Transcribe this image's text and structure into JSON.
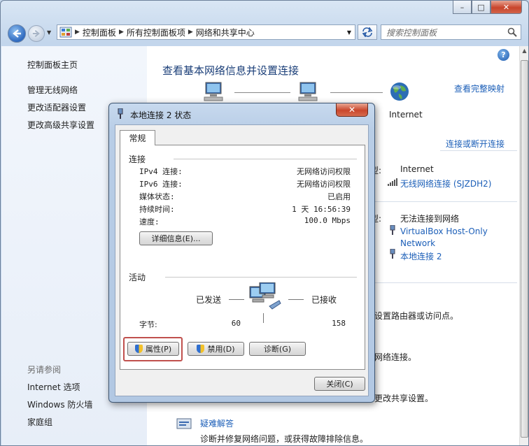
{
  "window": {
    "caption_buttons": {
      "minimize": "–",
      "maximize": "□",
      "close": "✕"
    }
  },
  "addressbar": {
    "crumbs": [
      "控制面板",
      "所有控制面板项",
      "网络和共享中心"
    ],
    "search_placeholder": "搜索控制面板"
  },
  "sidebar": {
    "home": "控制面板主页",
    "links": [
      "管理无线网络",
      "更改适配器设置",
      "更改高级共享设置"
    ],
    "see_also": "另请参阅",
    "see_also_links": [
      "Internet 选项",
      "Windows 防火墙",
      "家庭组"
    ]
  },
  "main": {
    "title": "查看基本网络信息并设置连接",
    "see_full_map": "查看完整映射",
    "internet_label": "Internet",
    "connect_disconnect": "连接或断开连接",
    "net1": {
      "type_label": "型:",
      "type_value": "Internet",
      "conn_link": "无线网络连接 (SJZDH2)"
    },
    "net2": {
      "type_label": "型:",
      "type_value": "无法连接到网络",
      "conn_link1": "VirtualBox Host-Only",
      "conn_link1b": "Network",
      "conn_link2": "本地连接 2"
    },
    "frag1": "设置路由器或访问点。",
    "frag2": "网络连接。",
    "frag3": "更改共享设置。",
    "troubleshoot": "疑难解答",
    "troubleshoot_desc": "诊断并修复网络问题，或获得故障排除信息。"
  },
  "dialog": {
    "title": "本地连接 2 状态",
    "close": "✕",
    "tab": "常规",
    "connection_group": "连接",
    "rows": [
      {
        "label": "IPv4 连接:",
        "value": "无网络访问权限"
      },
      {
        "label": "IPv6 连接:",
        "value": "无网络访问权限"
      },
      {
        "label": "媒体状态:",
        "value": "已启用"
      },
      {
        "label": "持续时间:",
        "value": "1 天 16:56:39"
      },
      {
        "label": "速度:",
        "value": "100.0 Mbps"
      }
    ],
    "details_button": "详细信息(E)...",
    "activity_group": "活动",
    "sent_label": "已发送",
    "received_label": "已接收",
    "bytes_label": "字节:",
    "bytes_sent": "60",
    "bytes_received": "158",
    "properties_button": "属性(P)",
    "disable_button": "禁用(D)",
    "diagnose_button": "诊断(G)",
    "close_button": "关闭(C)",
    "highlight_color": "#c0504d"
  }
}
